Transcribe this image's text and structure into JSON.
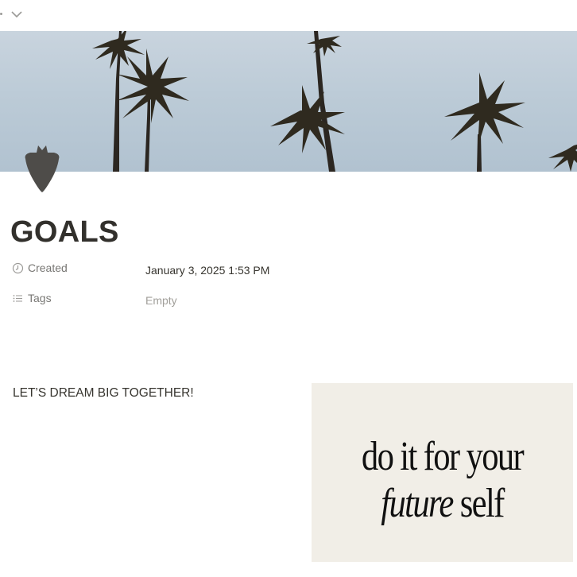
{
  "page": {
    "title": "GOALS",
    "icon": "strawberry-icon",
    "cover": "palm-trees-cover"
  },
  "properties": {
    "created": {
      "label": "Created",
      "value": "January 3, 2025 1:53 PM",
      "icon": "clock-icon"
    },
    "tags": {
      "label": "Tags",
      "value": "Empty",
      "icon": "list-icon"
    }
  },
  "content": {
    "text": "LET’S DREAM BIG TOGETHER!",
    "image": {
      "line1": "do it for your",
      "line2_italic": "future",
      "line2_rest": " self"
    }
  },
  "colors": {
    "text": "#37352f",
    "muted": "#787774",
    "placeholder": "#a19f9a"
  }
}
